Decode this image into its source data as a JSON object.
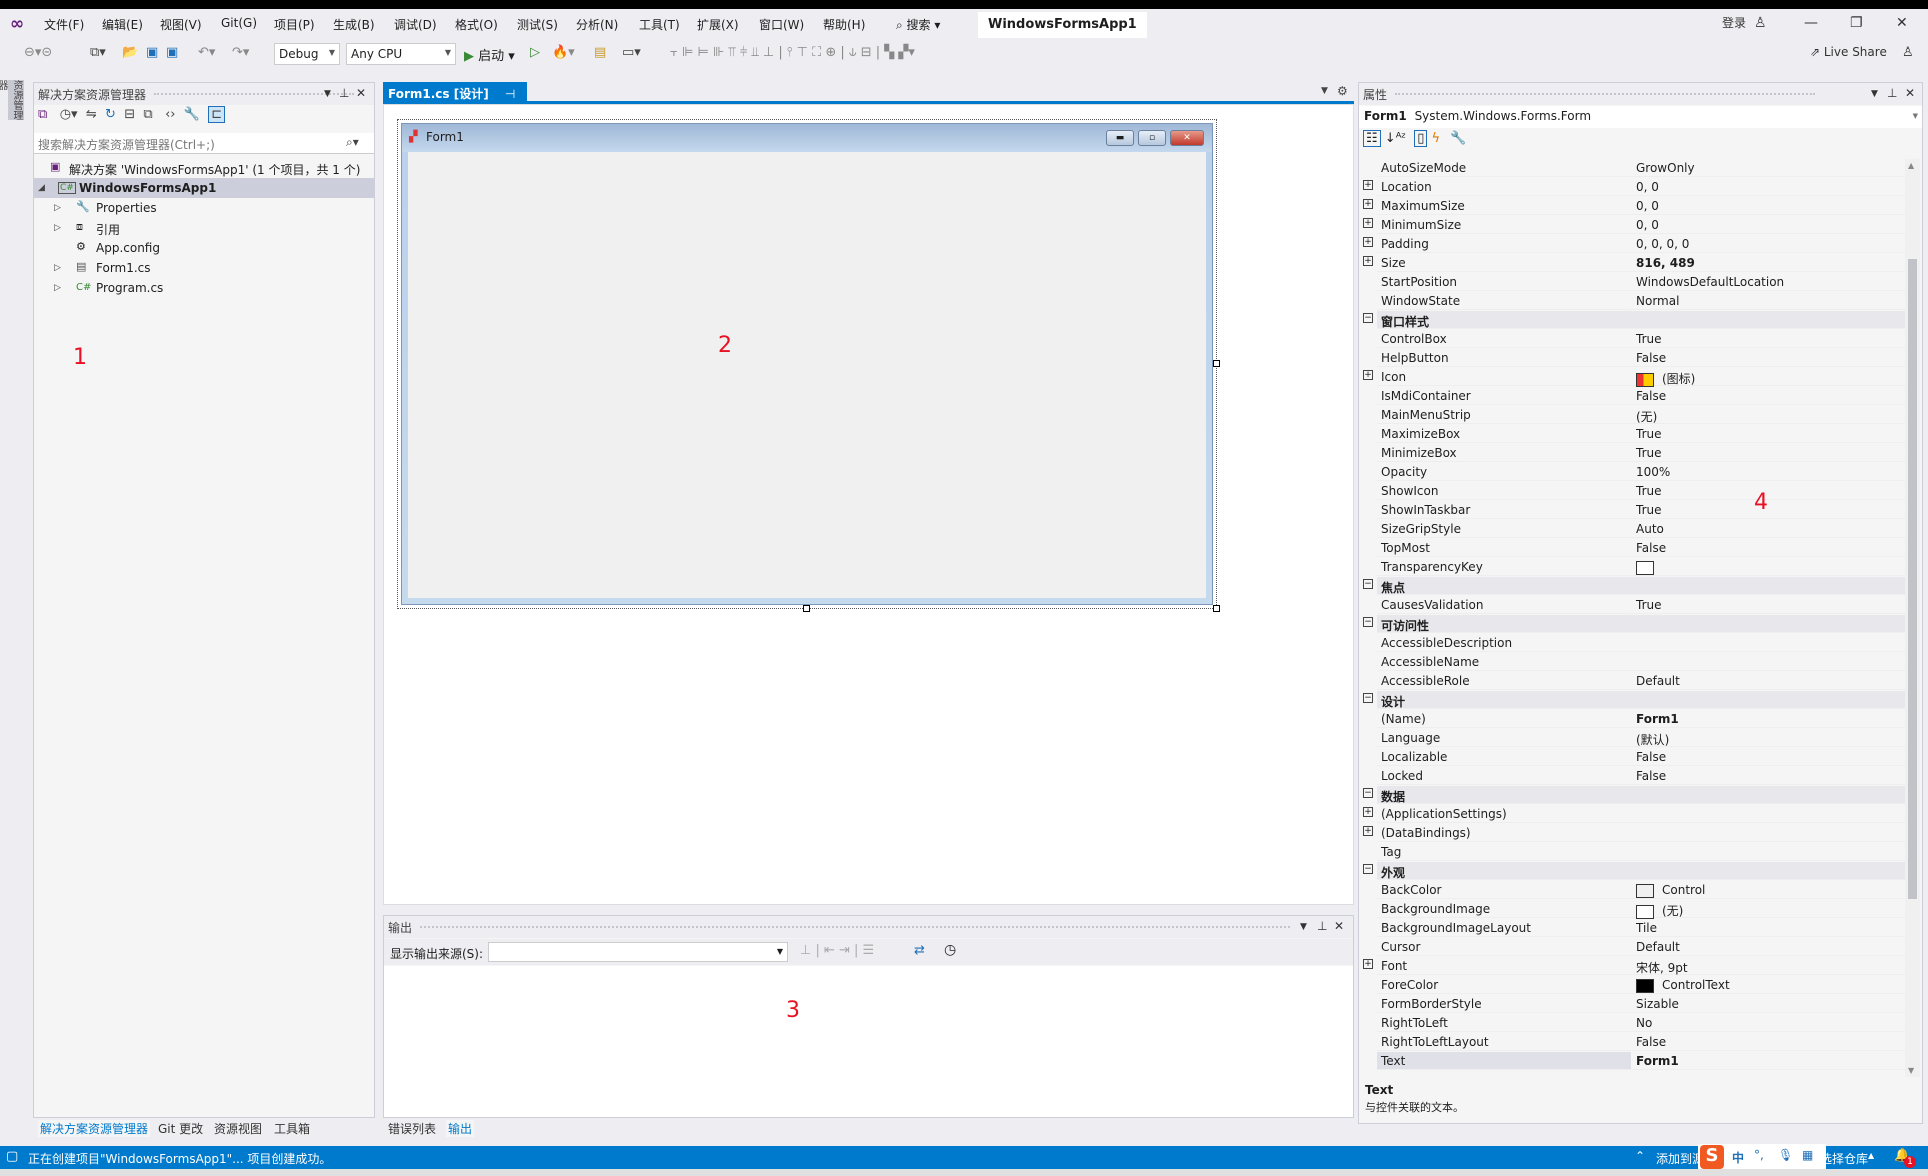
{
  "window": {
    "title": "WindowsFormsApp1",
    "login": "登录",
    "live_share": "Live Share"
  },
  "menu": [
    "文件(F)",
    "编辑(E)",
    "视图(V)",
    "Git(G)",
    "项目(P)",
    "生成(B)",
    "调试(D)",
    "格式(O)",
    "测试(S)",
    "分析(N)",
    "工具(T)",
    "扩展(X)",
    "窗口(W)",
    "帮助(H)"
  ],
  "search_label": "搜索",
  "toolbar": {
    "config": "Debug",
    "platform": "Any CPU",
    "start": "启动"
  },
  "left_strip": "资源管理器",
  "solution_explorer": {
    "title": "解决方案资源管理器",
    "search_placeholder": "搜索解决方案资源管理器(Ctrl+;)",
    "items": [
      {
        "label": "解决方案 'WindowsFormsApp1' (1 个项目，共 1 个)",
        "icon": "solution-icon"
      },
      {
        "label": "WindowsFormsApp1",
        "icon": "csharp-project-icon",
        "expanded": true,
        "selected": true
      },
      {
        "label": "Properties",
        "icon": "wrench-icon"
      },
      {
        "label": "引用",
        "icon": "references-icon"
      },
      {
        "label": "App.config",
        "icon": "config-icon"
      },
      {
        "label": "Form1.cs",
        "icon": "form-icon"
      },
      {
        "label": "Program.cs",
        "icon": "csharp-file-icon"
      }
    ],
    "bottom_tabs": [
      "解决方案资源管理器",
      "Git 更改",
      "资源视图",
      "工具箱"
    ]
  },
  "document": {
    "tab": "Form1.cs [设计]",
    "form_title": "Form1"
  },
  "annotations": [
    "1",
    "2",
    "3",
    "4"
  ],
  "output": {
    "title": "输出",
    "source_label": "显示输出来源(S):",
    "source_value": "",
    "bottom_tabs": [
      "错误列表",
      "输出"
    ]
  },
  "properties": {
    "title": "属性",
    "object_name": "Form1",
    "object_type": "System.Windows.Forms.Form",
    "rows": [
      {
        "name": "AutoSizeMode",
        "value": "GrowOnly"
      },
      {
        "name": "Location",
        "value": "0, 0",
        "expandable": true
      },
      {
        "name": "MaximumSize",
        "value": "0, 0",
        "expandable": true
      },
      {
        "name": "MinimumSize",
        "value": "0, 0",
        "expandable": true
      },
      {
        "name": "Padding",
        "value": "0, 0, 0, 0",
        "expandable": true
      },
      {
        "name": "Size",
        "value": "816, 489",
        "expandable": true,
        "bold": true
      },
      {
        "name": "StartPosition",
        "value": "WindowsDefaultLocation"
      },
      {
        "name": "WindowState",
        "value": "Normal"
      },
      {
        "category": "窗口样式"
      },
      {
        "name": "ControlBox",
        "value": "True"
      },
      {
        "name": "HelpButton",
        "value": "False"
      },
      {
        "name": "Icon",
        "value": "(图标)",
        "expandable": true,
        "swatch": "icon"
      },
      {
        "name": "IsMdiContainer",
        "value": "False"
      },
      {
        "name": "MainMenuStrip",
        "value": "(无)"
      },
      {
        "name": "MaximizeBox",
        "value": "True"
      },
      {
        "name": "MinimizeBox",
        "value": "True"
      },
      {
        "name": "Opacity",
        "value": "100%"
      },
      {
        "name": "ShowIcon",
        "value": "True"
      },
      {
        "name": "ShowInTaskbar",
        "value": "True"
      },
      {
        "name": "SizeGripStyle",
        "value": "Auto"
      },
      {
        "name": "TopMost",
        "value": "False"
      },
      {
        "name": "TransparencyKey",
        "value": "",
        "swatch": "#ffffff"
      },
      {
        "category": "焦点"
      },
      {
        "name": "CausesValidation",
        "value": "True"
      },
      {
        "category": "可访问性"
      },
      {
        "name": "AccessibleDescription",
        "value": ""
      },
      {
        "name": "AccessibleName",
        "value": ""
      },
      {
        "name": "AccessibleRole",
        "value": "Default"
      },
      {
        "category": "设计"
      },
      {
        "name": "(Name)",
        "value": "Form1",
        "bold": true
      },
      {
        "name": "Language",
        "value": "(默认)"
      },
      {
        "name": "Localizable",
        "value": "False"
      },
      {
        "name": "Locked",
        "value": "False"
      },
      {
        "category": "数据"
      },
      {
        "name": "(ApplicationSettings)",
        "value": "",
        "expandable": true
      },
      {
        "name": "(DataBindings)",
        "value": "",
        "expandable": true
      },
      {
        "name": "Tag",
        "value": ""
      },
      {
        "category": "外观"
      },
      {
        "name": "BackColor",
        "value": "Control",
        "swatch": "#f0f0f0"
      },
      {
        "name": "BackgroundImage",
        "value": "(无)",
        "swatch": "#ffffff"
      },
      {
        "name": "BackgroundImageLayout",
        "value": "Tile"
      },
      {
        "name": "Cursor",
        "value": "Default"
      },
      {
        "name": "Font",
        "value": "宋体, 9pt",
        "expandable": true
      },
      {
        "name": "ForeColor",
        "value": "ControlText",
        "swatch": "#000000"
      },
      {
        "name": "FormBorderStyle",
        "value": "Sizable"
      },
      {
        "name": "RightToLeft",
        "value": "No"
      },
      {
        "name": "RightToLeftLayout",
        "value": "False"
      },
      {
        "name": "Text",
        "value": "Form1",
        "bold": true,
        "selected": true
      }
    ],
    "description_title": "Text",
    "description_text": "与控件关联的文本。"
  },
  "status": {
    "message": "正在创建项目\"WindowsFormsApp1\"... 项目创建成功。",
    "source_control": "添加到源代码管理",
    "repo": "选择仓库",
    "ime": "中",
    "notifications": "1"
  },
  "colors": {
    "accent": "#007acc",
    "annotation": "#e81123"
  }
}
